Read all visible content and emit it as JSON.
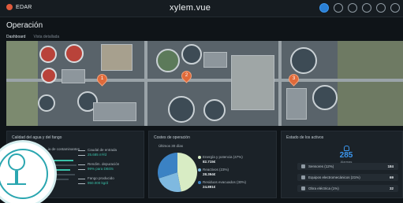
{
  "header": {
    "brand": "EDAR",
    "logo": "xylem.vue",
    "icons": [
      "home-icon",
      "refresh-icon",
      "gauge-icon",
      "camera-icon",
      "bell-icon",
      "gear-icon"
    ]
  },
  "page": {
    "title": "Operación",
    "tabs": [
      {
        "label": "Dashboard",
        "active": true
      },
      {
        "label": "Vista detallada",
        "active": false
      }
    ]
  },
  "map": {
    "pins": [
      "1",
      "2",
      "3"
    ]
  },
  "quality_panel": {
    "title": "Calidad del agua y del fango",
    "subtitle": "...ia de contaminantes",
    "stats": [
      {
        "label": "Caudal de entrada",
        "value": "25.685 m³/d"
      },
      {
        "label": "Rendim. depuración",
        "value": "99% para DBO5"
      },
      {
        "label": "Fango producido",
        "value": "950.000 kg/d"
      }
    ]
  },
  "costs_panel": {
    "title": "Costes de operación",
    "subtitle": "Últimos 30 días",
    "items": [
      {
        "label": "Energía y potencia (47%)",
        "value": "82.715€",
        "color": "#d8ecc4"
      },
      {
        "label": "Reactivos (23%)",
        "value": "28.394€",
        "color": "#7fb9e0"
      },
      {
        "label": "Residuos evacuados (30%)",
        "value": "24.891€",
        "color": "#3b82c4"
      }
    ]
  },
  "chart_data": {
    "type": "pie",
    "categories": [
      "Energía y potencia",
      "Reactivos",
      "Residuos evacuados"
    ],
    "values": [
      47,
      23,
      30
    ],
    "colors": [
      "#d8ecc4",
      "#7fb9e0",
      "#3b82c4"
    ]
  },
  "assets_panel": {
    "title": "Estado de los activos",
    "alarm_count": "285",
    "alarm_label": "Alarmas",
    "rows": [
      {
        "label": "Sensores (12%)",
        "value": "184"
      },
      {
        "label": "Equipos electromecánicos (21%)",
        "value": "69"
      },
      {
        "label": "Obra eléctrica (1%)",
        "value": "32"
      }
    ]
  }
}
